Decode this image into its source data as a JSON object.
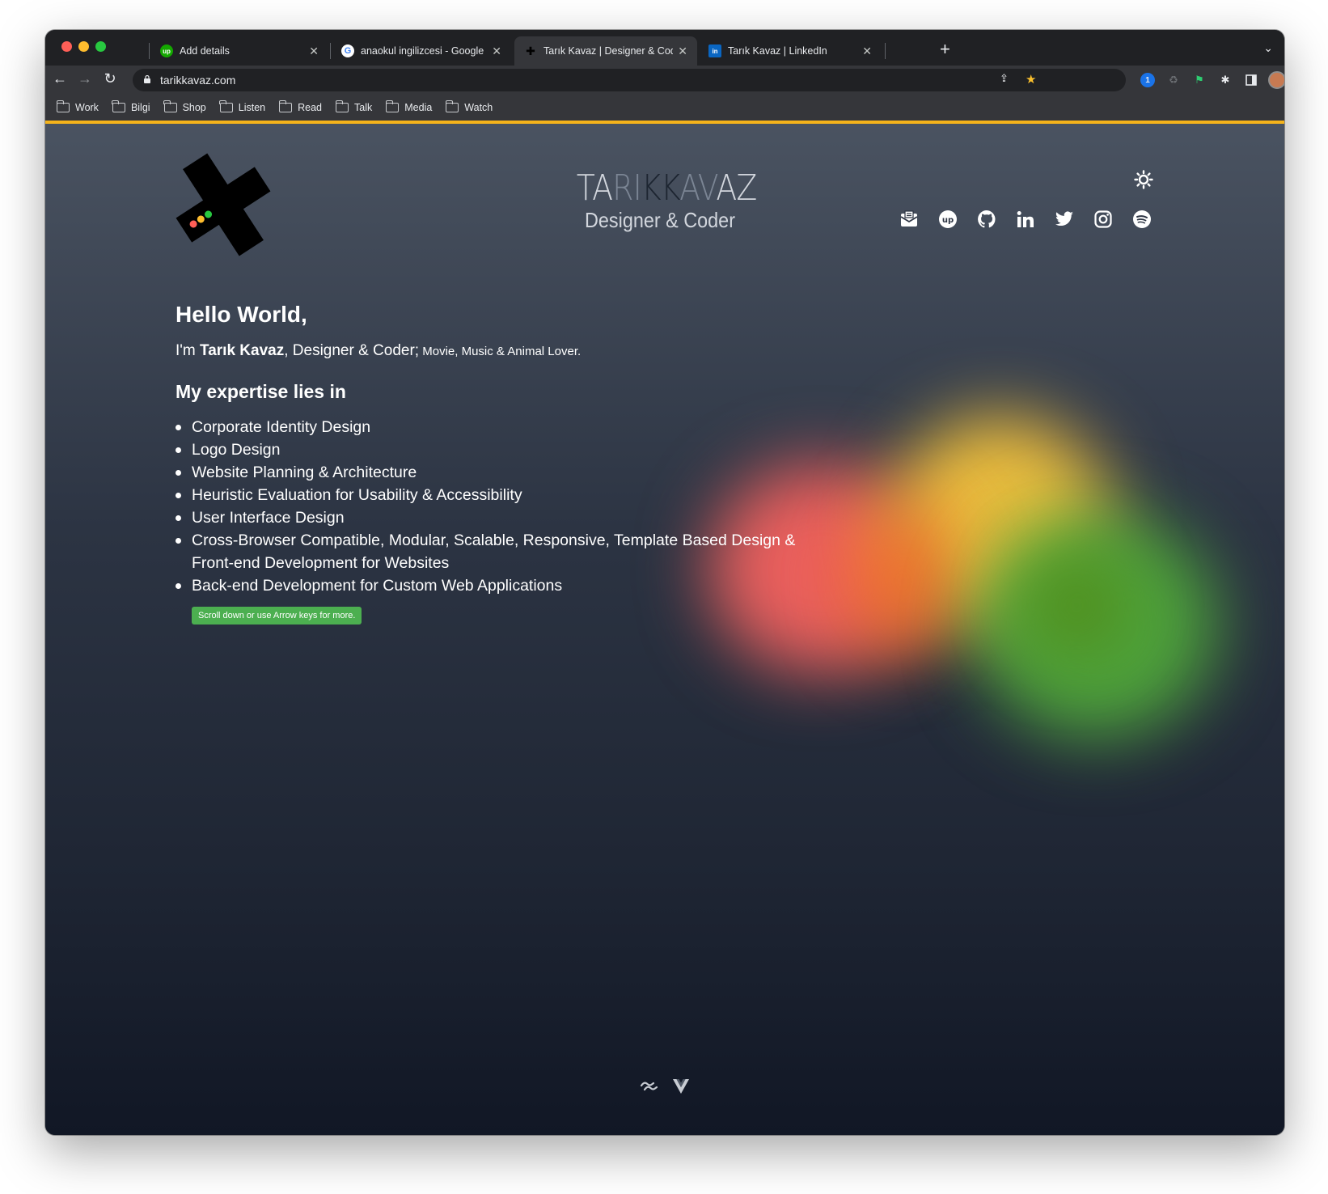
{
  "browser": {
    "tabs": [
      {
        "label": "Add details",
        "favicon": "upwork-icon",
        "favicon_text": "up",
        "favicon_color": "#14a800",
        "active": false
      },
      {
        "label": "anaokul ingilizcesi - Google Se",
        "favicon": "google-icon",
        "favicon_text": "G",
        "favicon_color": "#ffffff",
        "active": false
      },
      {
        "label": "Tarık Kavaz | Designer & Coder",
        "favicon": "tk-logo-icon",
        "favicon_text": "✚",
        "favicon_color": "#000000",
        "active": true
      },
      {
        "label": "Tarık Kavaz | LinkedIn",
        "favicon": "linkedin-icon",
        "favicon_text": "in",
        "favicon_color": "#0a66c2",
        "active": false
      }
    ],
    "url": "tarikkavaz.com",
    "bookmarks": [
      "Work",
      "Bilgi",
      "Shop",
      "Listen",
      "Read",
      "Talk",
      "Media",
      "Watch"
    ],
    "accent_color": "#f5b31b"
  },
  "header": {
    "brand": {
      "part1": "TA",
      "part2": "RI",
      "part3": "KK",
      "part4": "AV",
      "part5": "AZ"
    },
    "tagline": "Designer & Coder",
    "social_icons": [
      "mail-icon",
      "upwork-icon",
      "github-icon",
      "linkedin-icon",
      "twitter-icon",
      "instagram-icon",
      "spotify-icon"
    ]
  },
  "main": {
    "greeting": "Hello World,",
    "intro_prefix": "I'm ",
    "intro_name": "Tarık Kavaz",
    "intro_role": ", Designer & Coder;",
    "intro_tail": " Movie, Music & Animal Lover.",
    "expertise_heading": "My expertise lies in",
    "expertise": [
      "Corporate Identity Design",
      "Logo Design",
      "Website Planning & Architecture",
      "Heuristic Evaluation for Usability & Accessibility",
      "User Interface Design",
      "Cross-Browser Compatible, Modular, Scalable, Responsive, Template Based Design & Front-end Development for Websites",
      "Back-end Development for Custom Web Applications"
    ],
    "scroll_hint": "Scroll down or use Arrow keys for more."
  }
}
